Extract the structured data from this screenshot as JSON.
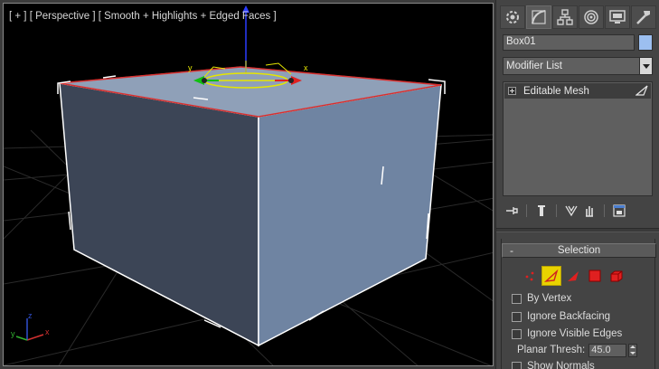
{
  "viewport": {
    "label": "[ + ] [ Perspective ] [ Smooth + Highlights + Edged Faces ]",
    "gizmo_axes": {
      "x": "x",
      "y": "y"
    },
    "corner_axes": {
      "x": "x",
      "y": "y",
      "z": "z"
    }
  },
  "command_panel": {
    "tabs": [
      "create-icon",
      "modify-icon",
      "hierarchy-icon",
      "motion-icon",
      "display-icon",
      "utilities-icon"
    ],
    "active_tab": "modify-icon",
    "object_name": "Box01",
    "object_color": "#9cbff0",
    "modifier_list_label": "Modifier List",
    "stack": [
      {
        "label": "Editable Mesh"
      }
    ],
    "stack_tools": [
      "pin-stack-icon",
      "show-end-result-icon",
      "make-unique-icon",
      "remove-modifier-icon",
      "configure-modifier-sets-icon"
    ],
    "selection_rollout": {
      "collapse_symbol": "-",
      "title": "Selection",
      "subobject_icons": [
        "vertex-icon",
        "edge-icon",
        "face-icon",
        "polygon-icon",
        "element-icon"
      ],
      "active_subobject": "edge-icon",
      "options": [
        {
          "label": "By Vertex",
          "checked": false
        },
        {
          "label": "Ignore Backfacing",
          "checked": false
        },
        {
          "label": "Ignore Visible Edges",
          "checked": false
        }
      ],
      "planar_thresh_label": "Planar Thresh:",
      "planar_thresh_value": "45.0",
      "show_normals_label": "Show Normals"
    }
  },
  "colors": {
    "viewport_bg": "#000000",
    "box_top": "#8fa0b8",
    "box_front": "#6f84a2",
    "box_left": "#3c4556",
    "selected_edge": "#d8302f",
    "active_subobject_bg": "#e8d200"
  }
}
